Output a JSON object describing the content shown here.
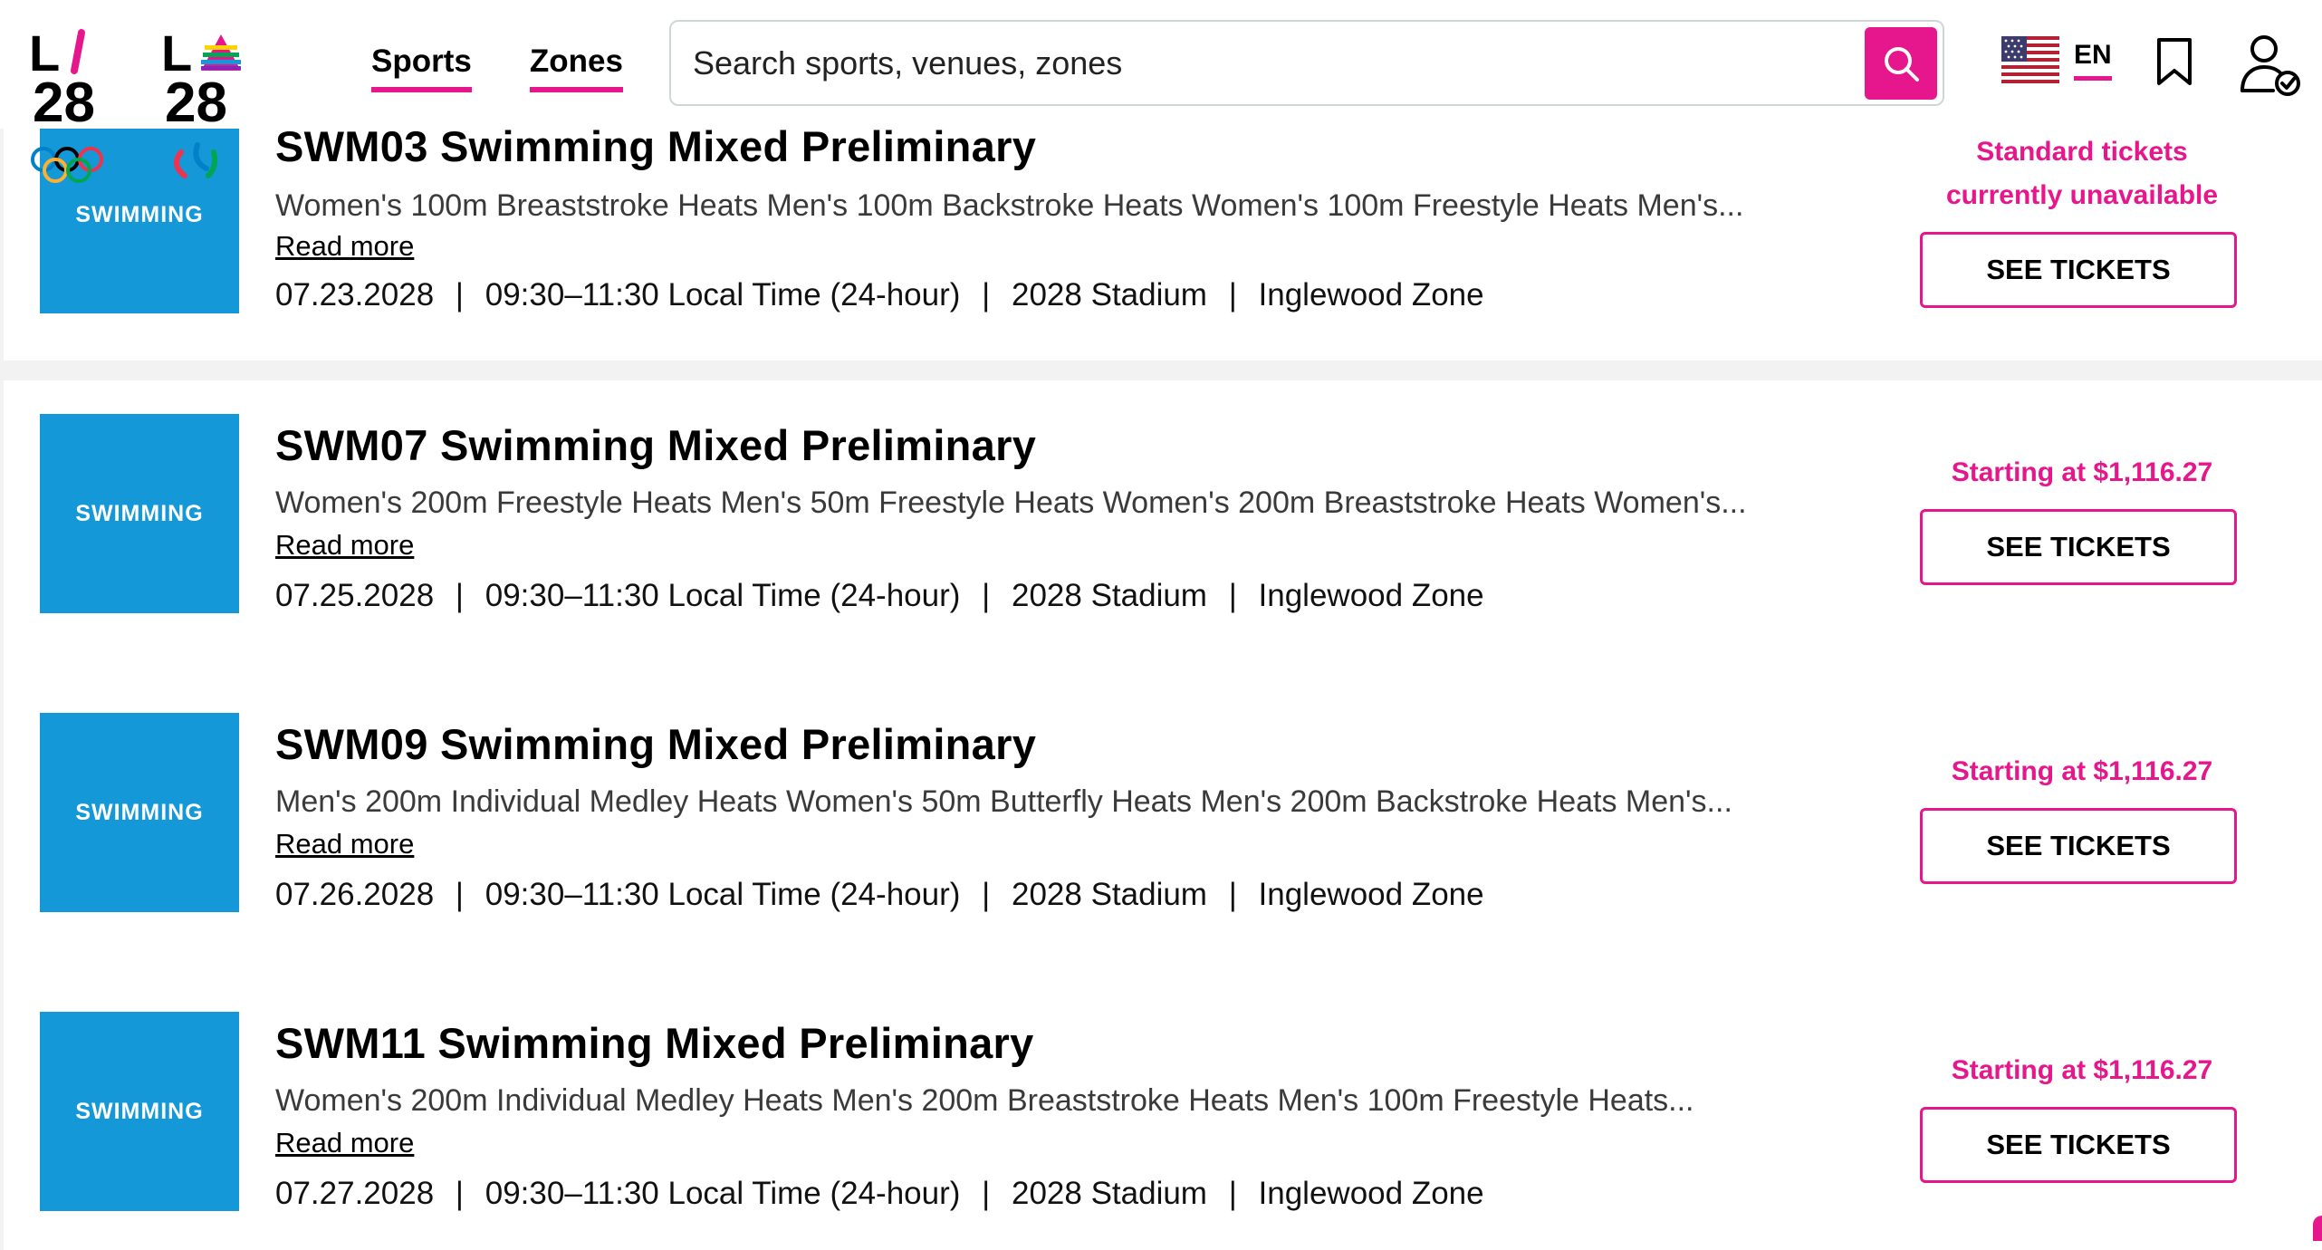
{
  "header": {
    "logo_olympic": "LA28",
    "logo_paralympic": "LA28",
    "nav": [
      "Sports",
      "Zones"
    ],
    "search": {
      "placeholder": "Search sports, venues, zones"
    },
    "language": "EN"
  },
  "events": [
    {
      "code_title": "SWM03 Swimming Mixed Preliminary",
      "tile_label": "SWIMMING",
      "description": "Women's 100m Breaststroke Heats Men's 100m Backstroke Heats Women's 100m Freestyle Heats Men's...",
      "read_more": "Read more",
      "date": "07.23.2028",
      "time": "09:30–11:30 Local Time (24-hour)",
      "venue": "2028 Stadium",
      "zone": "Inglewood Zone",
      "price_text": "Standard tickets currently unavailable",
      "button": "SEE TICKETS"
    },
    {
      "code_title": "SWM07 Swimming Mixed Preliminary",
      "tile_label": "SWIMMING",
      "description": "Women's 200m Freestyle Heats Men's 50m Freestyle Heats Women's 200m Breaststroke Heats Women's...",
      "read_more": "Read more",
      "date": "07.25.2028",
      "time": "09:30–11:30 Local Time (24-hour)",
      "venue": "2028 Stadium",
      "zone": "Inglewood Zone",
      "price_text": "Starting at $1,116.27",
      "button": "SEE TICKETS"
    },
    {
      "code_title": "SWM09 Swimming Mixed Preliminary",
      "tile_label": "SWIMMING",
      "description": "Men's 200m Individual Medley Heats Women's 50m Butterfly Heats Men's 200m Backstroke Heats Men's...",
      "read_more": "Read more",
      "date": "07.26.2028",
      "time": "09:30–11:30 Local Time (24-hour)",
      "venue": "2028 Stadium",
      "zone": "Inglewood Zone",
      "price_text": "Starting at $1,116.27",
      "button": "SEE TICKETS"
    },
    {
      "code_title": "SWM11 Swimming Mixed Preliminary",
      "tile_label": "SWIMMING",
      "description": "Women's 200m Individual Medley Heats Men's 200m Breaststroke Heats Men's 100m Freestyle Heats...",
      "read_more": "Read more",
      "date": "07.27.2028",
      "time": "09:30–11:30 Local Time (24-hour)",
      "venue": "2028 Stadium",
      "zone": "Inglewood Zone",
      "price_text": "Starting at $1,116.27",
      "button": "SEE TICKETS"
    }
  ],
  "separator": "|",
  "colors": {
    "accent_pink": "#E6168C",
    "tile_blue": "#1598D8",
    "page_bg": "#F2F2F2"
  },
  "icons": {
    "search": "search-icon",
    "flag": "us-flag-icon",
    "bookmark": "bookmark-icon",
    "profile": "user-check-icon"
  }
}
